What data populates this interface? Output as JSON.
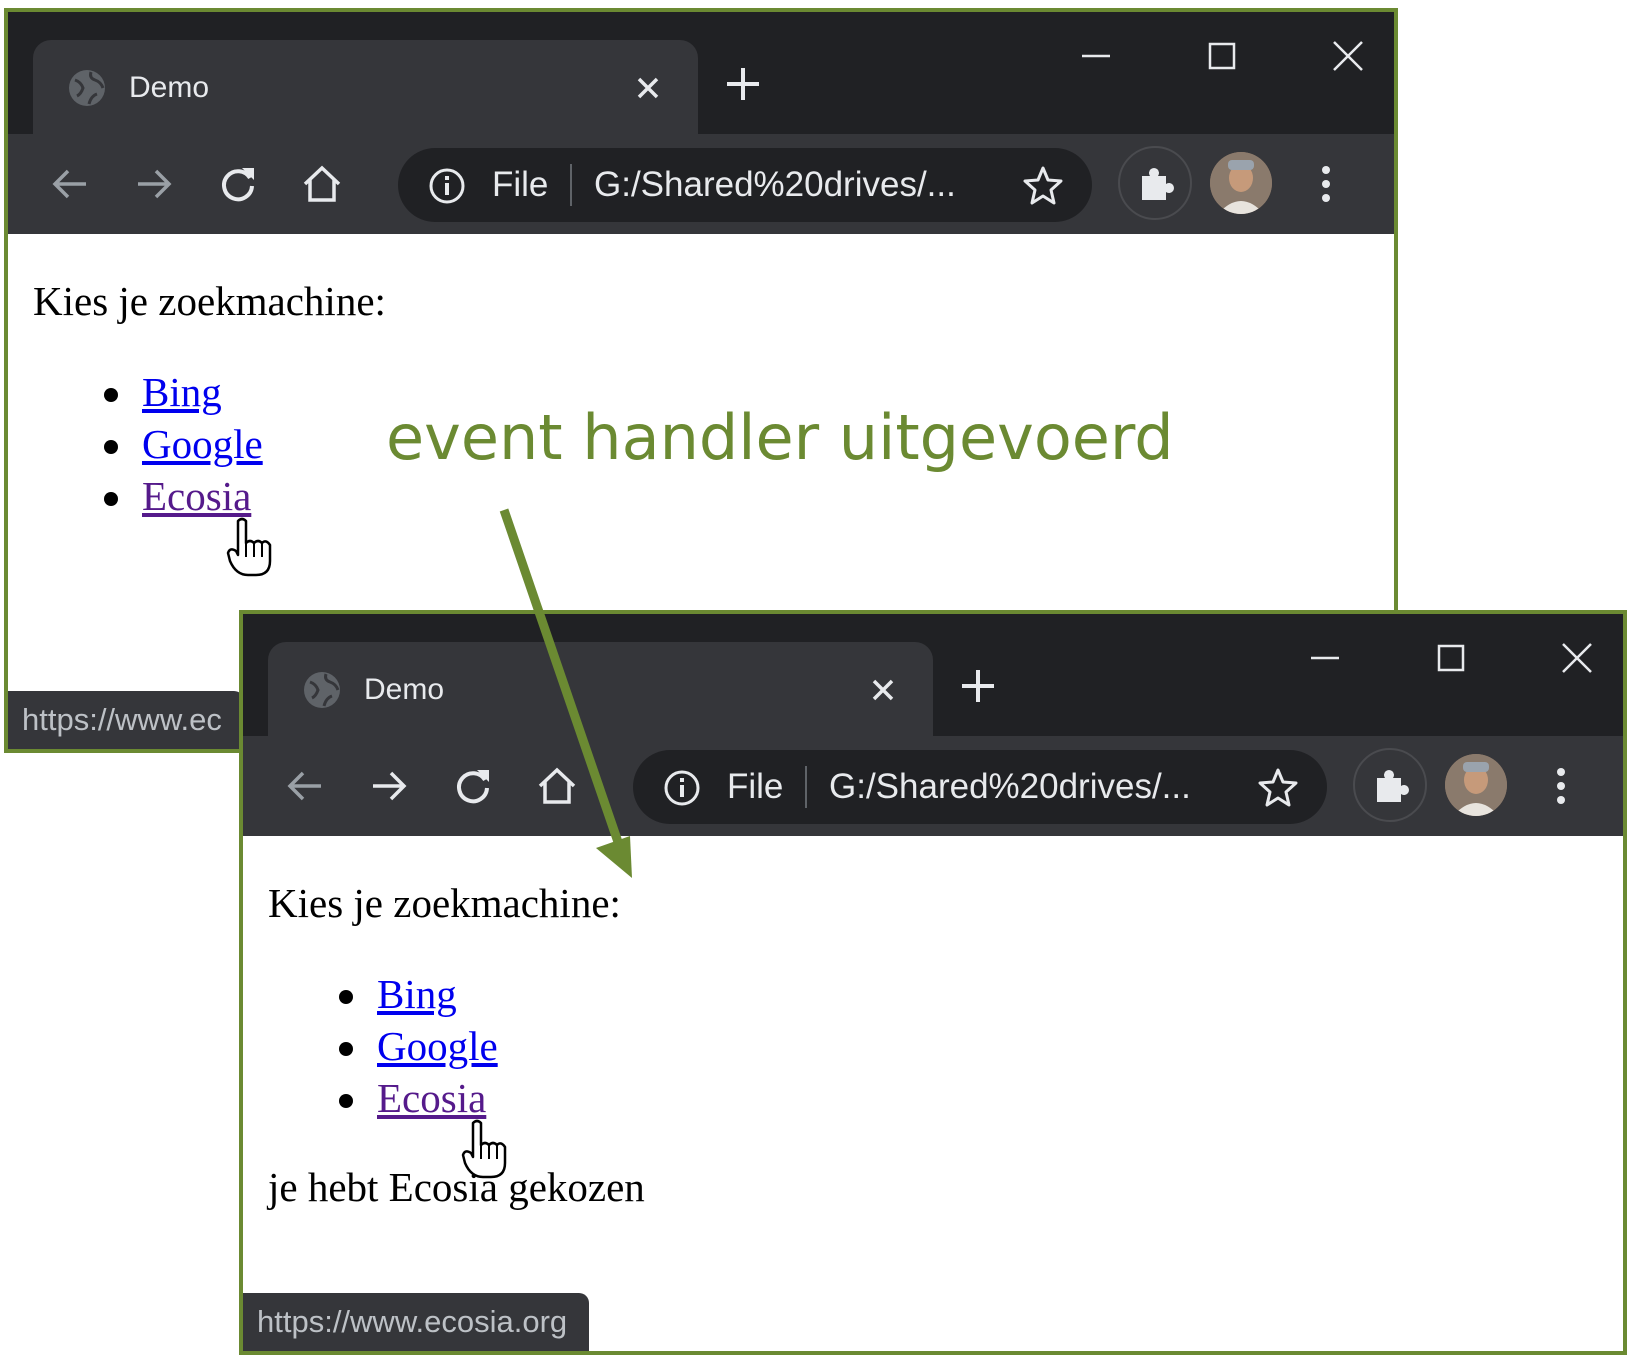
{
  "annotation": "event handler uitgevoerd",
  "window_before": {
    "tab": {
      "title": "Demo"
    },
    "omnibox": {
      "scheme": "File",
      "url": "G:/Shared%20drives/..."
    },
    "content": {
      "prompt": "Kies je zoekmachine:",
      "links": [
        "Bing",
        "Google",
        "Ecosia"
      ]
    },
    "status_url": "https://www.ec"
  },
  "window_after": {
    "tab": {
      "title": "Demo"
    },
    "omnibox": {
      "scheme": "File",
      "url": "G:/Shared%20drives/..."
    },
    "content": {
      "prompt": "Kies je zoekmachine:",
      "links": [
        "Bing",
        "Google",
        "Ecosia"
      ],
      "result": "je hebt Ecosia gekozen"
    },
    "status_url": "https://www.ecosia.org"
  },
  "colors": {
    "frame_border": "#6b8a32",
    "annotation": "#6b8a32",
    "link": "#0000ee",
    "visited_link": "#551a8b",
    "tab_strip": "#202124",
    "toolbar": "#35363a"
  }
}
